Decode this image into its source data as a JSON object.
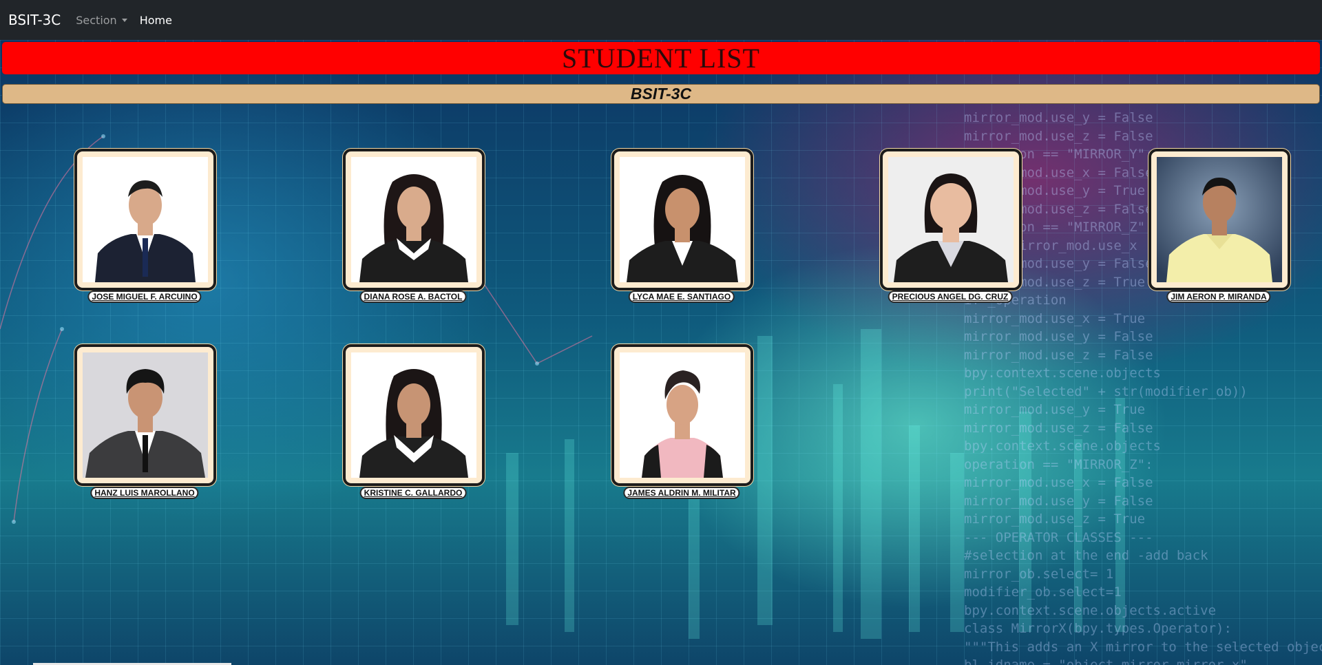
{
  "navbar": {
    "brand": "BSIT-3C",
    "section_label": "Section",
    "home_label": "Home"
  },
  "header": {
    "title": "STUDENT LIST",
    "section": "BSIT-3C"
  },
  "students": [
    {
      "name": "JOSE MIGUEL F. ARCUINO"
    },
    {
      "name": "DIANA ROSE A. BACTOL"
    },
    {
      "name": "LYCA MAE E. SANTIAGO"
    },
    {
      "name": "PRECIOUS ANGEL DG. CRUZ"
    },
    {
      "name": "JIM AERON P. MIRANDA"
    },
    {
      "name": "HANZ LUIS MAROLLANO"
    },
    {
      "name": "KRISTINE C. GALLARDO"
    },
    {
      "name": "JAMES ALDRIN M. MILITAR"
    }
  ],
  "background_code": [
    "mirror_mod.use_y = False",
    "mirror_mod.use_z = False",
    "operation == \"MIRROR_Y\":",
    "mirror_mod.use_x = False",
    "mirror_mod.use_y = True",
    "mirror_mod.use_z = False",
    "operation == \"MIRROR_Z\":",
    "  set mirror_mod.use_x",
    "mirror_mod.use_y = False",
    "mirror_mod.use_z = True",
    "if _operation",
    "mirror_mod.use_x = True",
    "mirror_mod.use_y = False",
    "mirror_mod.use_z = False",
    "bpy.context.scene.objects",
    "print(\"Selected\" + str(modifier_ob))",
    "mirror_mod.use_y = True",
    "mirror_mod.use_z = False",
    "bpy.context.scene.objects",
    "operation == \"MIRROR_Z\":",
    "mirror_mod.use_x = False",
    "mirror_mod.use_y = False",
    "mirror_mod.use_z = True",
    "--- OPERATOR CLASSES ---",
    "#selection at the end -add back",
    "mirror_ob.select= 1",
    "modifier_ob.select=1",
    "bpy.context.scene.objects.active",
    "class MirrorX(bpy.types.Operator):",
    "\"\"\"This adds an X mirror to the selected object\"\"\"",
    "bl_idname = \"object.mirror_mirror_x\""
  ],
  "colors": {
    "navbar_bg": "#212529",
    "title_bar": "#ff0000",
    "section_bar": "#deb887",
    "card_bg": "#fdebd0"
  }
}
